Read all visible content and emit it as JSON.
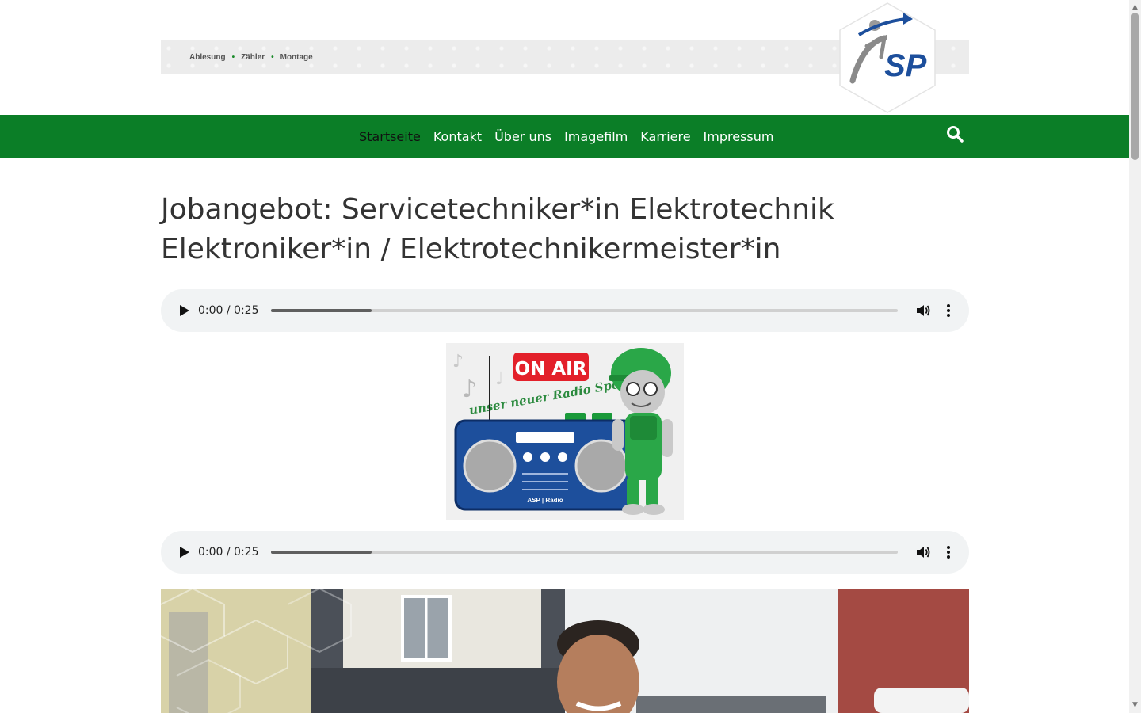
{
  "header": {
    "top_links": [
      "Ablesung",
      "Zähler",
      "Montage"
    ],
    "separator": "•",
    "logo": {
      "icon": "asp-logo-icon",
      "text": "SP"
    }
  },
  "nav": {
    "items": [
      {
        "label": "Startseite",
        "active": true
      },
      {
        "label": "Kontakt",
        "active": false
      },
      {
        "label": "Über uns",
        "active": false
      },
      {
        "label": "Imagefilm",
        "active": false
      },
      {
        "label": "Karriere",
        "active": false
      },
      {
        "label": "Impressum",
        "active": false
      }
    ],
    "search_icon": "search-icon",
    "bg_color": "#0b7e27"
  },
  "page": {
    "title_line1": "Jobangebot: Servicetechniker*in Elektrotechnik",
    "title_line2": "Elektroniker*in / Elektrotechnikermeister*in"
  },
  "audio_players": [
    {
      "time": "0:00 / 0:25",
      "buffered": 0.16
    },
    {
      "time": "0:00 / 0:25",
      "buffered": 0.16
    }
  ],
  "radio_image": {
    "badge": "ON AIR",
    "slogan": "unser neuer Radio Spot",
    "radio_label": "ASP | Radio"
  },
  "colors": {
    "brand_green": "#0b7e27",
    "on_air_red": "#e3202a",
    "radio_blue": "#1d4f9c"
  }
}
